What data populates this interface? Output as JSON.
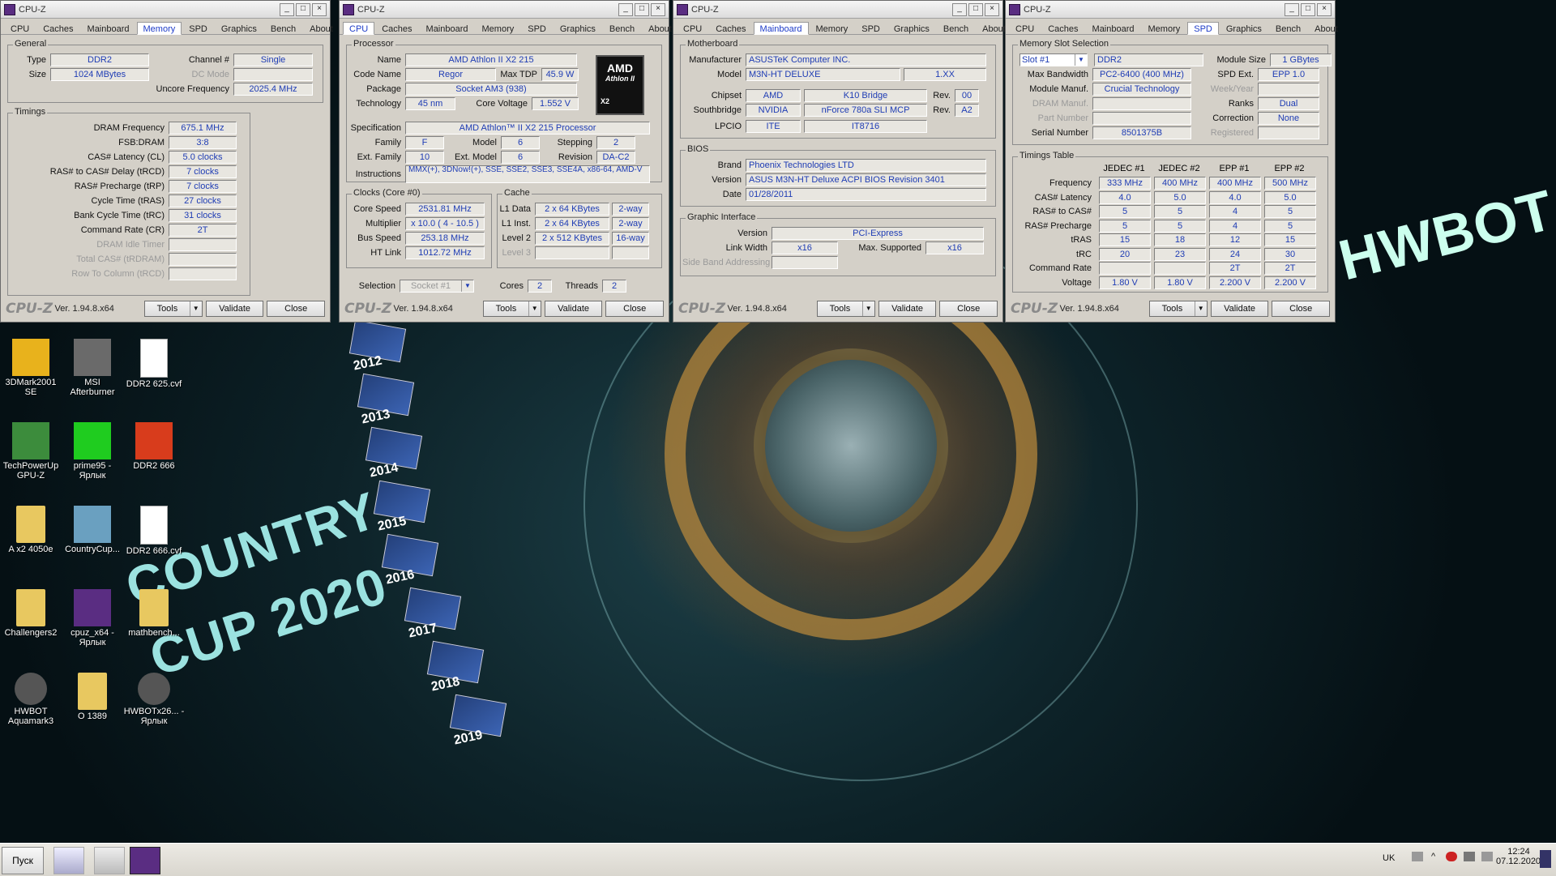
{
  "app_title": "CPU-Z",
  "tabs": [
    "CPU",
    "Caches",
    "Mainboard",
    "Memory",
    "SPD",
    "Graphics",
    "Bench",
    "About"
  ],
  "footer": {
    "logo": "CPU-Z",
    "version": "Ver. 1.94.8.x64",
    "tools": "Tools",
    "validate": "Validate",
    "close": "Close"
  },
  "memory": {
    "general_title": "General",
    "type_label": "Type",
    "type": "DDR2",
    "size_label": "Size",
    "size": "1024 MBytes",
    "channel_label": "Channel #",
    "channel": "Single",
    "dcmode_label": "DC Mode",
    "dcmode": "",
    "uncore_label": "Uncore Frequency",
    "uncore": "2025.4 MHz",
    "timings_title": "Timings",
    "timings": [
      {
        "label": "DRAM Frequency",
        "value": "675.1 MHz",
        "disabled": false
      },
      {
        "label": "FSB:DRAM",
        "value": "3:8",
        "disabled": false
      },
      {
        "label": "CAS# Latency (CL)",
        "value": "5.0 clocks",
        "disabled": false
      },
      {
        "label": "RAS# to CAS# Delay (tRCD)",
        "value": "7 clocks",
        "disabled": false
      },
      {
        "label": "RAS# Precharge (tRP)",
        "value": "7 clocks",
        "disabled": false
      },
      {
        "label": "Cycle Time (tRAS)",
        "value": "27 clocks",
        "disabled": false
      },
      {
        "label": "Bank Cycle Time (tRC)",
        "value": "31 clocks",
        "disabled": false
      },
      {
        "label": "Command Rate (CR)",
        "value": "2T",
        "disabled": false
      },
      {
        "label": "DRAM Idle Timer",
        "value": "",
        "disabled": true
      },
      {
        "label": "Total CAS# (tRDRAM)",
        "value": "",
        "disabled": true
      },
      {
        "label": "Row To Column (tRCD)",
        "value": "",
        "disabled": true
      }
    ]
  },
  "cpu": {
    "processor_title": "Processor",
    "name_label": "Name",
    "name": "AMD Athlon II X2 215",
    "codename_label": "Code Name",
    "codename": "Regor",
    "maxtdp_label": "Max TDP",
    "maxtdp": "45.9 W",
    "package_label": "Package",
    "package": "Socket AM3 (938)",
    "tech_label": "Technology",
    "tech": "45 nm",
    "voltage_label": "Core Voltage",
    "voltage": "1.552 V",
    "spec_label": "Specification",
    "spec": "AMD Athlon™ II X2 215 Processor",
    "family_label": "Family",
    "family": "F",
    "model_label": "Model",
    "model": "6",
    "stepping_label": "Stepping",
    "stepping": "2",
    "extfamily_label": "Ext. Family",
    "extfamily": "10",
    "extmodel_label": "Ext. Model",
    "extmodel": "6",
    "revision_label": "Revision",
    "revision": "DA-C2",
    "instr_label": "Instructions",
    "instr": "MMX(+), 3DNow!(+), SSE, SSE2, SSE3, SSE4A, x86-64, AMD-V",
    "logo_brand": "AMD",
    "logo_line": "Athlon II",
    "logo_sub": "X2",
    "clocks_title": "Clocks (Core #0)",
    "corespeed_label": "Core Speed",
    "corespeed": "2531.81 MHz",
    "multiplier_label": "Multiplier",
    "multiplier": "x 10.0 ( 4 - 10.5 )",
    "busspeed_label": "Bus Speed",
    "busspeed": "253.18 MHz",
    "htlink_label": "HT Link",
    "htlink": "1012.72 MHz",
    "cache_title": "Cache",
    "l1d_label": "L1 Data",
    "l1d": "2 x 64 KBytes",
    "l1d_way": "2-way",
    "l1i_label": "L1 Inst.",
    "l1i": "2 x 64 KBytes",
    "l1i_way": "2-way",
    "l2_label": "Level 2",
    "l2": "2 x 512 KBytes",
    "l2_way": "16-way",
    "l3_label": "Level 3",
    "l3": "",
    "l3_way": "",
    "selection_label": "Selection",
    "selection": "Socket #1",
    "cores_label": "Cores",
    "cores": "2",
    "threads_label": "Threads",
    "threads": "2"
  },
  "mainboard": {
    "mb_title": "Motherboard",
    "manufacturer_label": "Manufacturer",
    "manufacturer": "ASUSTeK Computer INC.",
    "model_label": "Model",
    "model": "M3N-HT DELUXE",
    "model_rev": "1.XX",
    "chipset_label": "Chipset",
    "chipset_vendor": "AMD",
    "chipset": "K10 Bridge",
    "chipset_rev_label": "Rev.",
    "chipset_rev": "00",
    "southbridge_label": "Southbridge",
    "sb_vendor": "NVIDIA",
    "sb": "nForce 780a SLI MCP",
    "sb_rev_label": "Rev.",
    "sb_rev": "A2",
    "lpcio_label": "LPCIO",
    "lpcio_vendor": "ITE",
    "lpcio": "IT8716",
    "bios_title": "BIOS",
    "brand_label": "Brand",
    "brand": "Phoenix Technologies LTD",
    "version_label": "Version",
    "version": "ASUS M3N-HT Deluxe ACPI BIOS Revision 3401",
    "date_label": "Date",
    "date": "01/28/2011",
    "gi_title": "Graphic Interface",
    "giversion_label": "Version",
    "giversion": "PCI-Express",
    "linkwidth_label": "Link Width",
    "linkwidth": "x16",
    "maxsup_label": "Max. Supported",
    "maxsup": "x16",
    "sideband_label": "Side Band Addressing",
    "sideband": ""
  },
  "spd": {
    "slot_title": "Memory Slot Selection",
    "slot": "Slot #1",
    "slot_type": "DDR2",
    "modsize_label": "Module Size",
    "modsize": "1 GBytes",
    "maxbw_label": "Max Bandwidth",
    "maxbw": "PC2-6400 (400 MHz)",
    "spdext_label": "SPD Ext.",
    "spdext": "EPP 1.0",
    "modmanuf_label": "Module Manuf.",
    "modmanuf": "Crucial Technology",
    "weekyear_label": "Week/Year",
    "weekyear": "",
    "drammanuf_label": "DRAM Manuf.",
    "drammanuf": "",
    "ranks_label": "Ranks",
    "ranks": "Dual",
    "partnum_label": "Part Number",
    "partnum": "",
    "correction_label": "Correction",
    "correction": "None",
    "serial_label": "Serial Number",
    "serial": "8501375B",
    "registered_label": "Registered",
    "registered": "",
    "tt_title": "Timings Table",
    "tt_cols": [
      "JEDEC #1",
      "JEDEC #2",
      "EPP #1",
      "EPP #2"
    ],
    "tt_rows": [
      {
        "label": "Frequency",
        "values": [
          "333 MHz",
          "400 MHz",
          "400 MHz",
          "500 MHz"
        ]
      },
      {
        "label": "CAS# Latency",
        "values": [
          "4.0",
          "5.0",
          "4.0",
          "5.0"
        ]
      },
      {
        "label": "RAS# to CAS#",
        "values": [
          "5",
          "5",
          "4",
          "5"
        ]
      },
      {
        "label": "RAS# Precharge",
        "values": [
          "5",
          "5",
          "4",
          "5"
        ]
      },
      {
        "label": "tRAS",
        "values": [
          "15",
          "18",
          "12",
          "15"
        ]
      },
      {
        "label": "tRC",
        "values": [
          "20",
          "23",
          "24",
          "30"
        ]
      },
      {
        "label": "Command Rate",
        "values": [
          "",
          "",
          "2T",
          "2T"
        ]
      },
      {
        "label": "Voltage",
        "values": [
          "1.80 V",
          "1.80 V",
          "2.200 V",
          "2.200 V"
        ]
      }
    ]
  },
  "desktop": {
    "icons": [
      {
        "label": "3DMark2001 SE",
        "icon": "3dmark-icon",
        "color": "#e8b21c"
      },
      {
        "label": "MSI Afterburner",
        "icon": "afterburner-icon",
        "color": "#6a6a6a"
      },
      {
        "label": "DDR2 625.cvf",
        "icon": "file-icon",
        "color": "#ffffff"
      },
      {
        "label": "TechPowerUp GPU-Z",
        "icon": "gpuz-icon",
        "color": "#3c8c3c"
      },
      {
        "label": "prime95 - Ярлык",
        "icon": "prime95-icon",
        "color": "#1fcc1f"
      },
      {
        "label": "DDR2 666",
        "icon": "flower-icon",
        "color": "#d83c1c"
      },
      {
        "label": "A x2 4050e",
        "icon": "folder-icon",
        "color": "#e8c860"
      },
      {
        "label": "CountryCup...",
        "icon": "image-icon",
        "color": "#6aa0c0"
      },
      {
        "label": "DDR2 666.cvf",
        "icon": "file-icon",
        "color": "#ffffff"
      },
      {
        "label": "Challengers2",
        "icon": "folder-icon",
        "color": "#e8c860"
      },
      {
        "label": "cpuz_x64 - Ярлык",
        "icon": "cpuz-icon",
        "color": "#5a2d82"
      },
      {
        "label": "mathbench...",
        "icon": "folder-icon",
        "color": "#e8c860"
      },
      {
        "label": "HWBOT Aquamark3",
        "icon": "hwbot-icon",
        "color": "#555555"
      },
      {
        "label": "O 1389",
        "icon": "folder-icon",
        "color": "#e8c860"
      },
      {
        "label": "HWBOTx26... - Ярлык",
        "icon": "hwbot-icon",
        "color": "#555555"
      }
    ],
    "wallpaper_text_1": "COUNTRY",
    "wallpaper_text_2": "CUP 2020",
    "wallpaper_brand": "HWBOT",
    "years": [
      "2012",
      "2013",
      "2014",
      "2015",
      "2016",
      "2017",
      "2018",
      "2019"
    ]
  },
  "taskbar": {
    "start": "Пуск",
    "lang": "UK",
    "time": "12:24",
    "date": "07.12.2020"
  }
}
